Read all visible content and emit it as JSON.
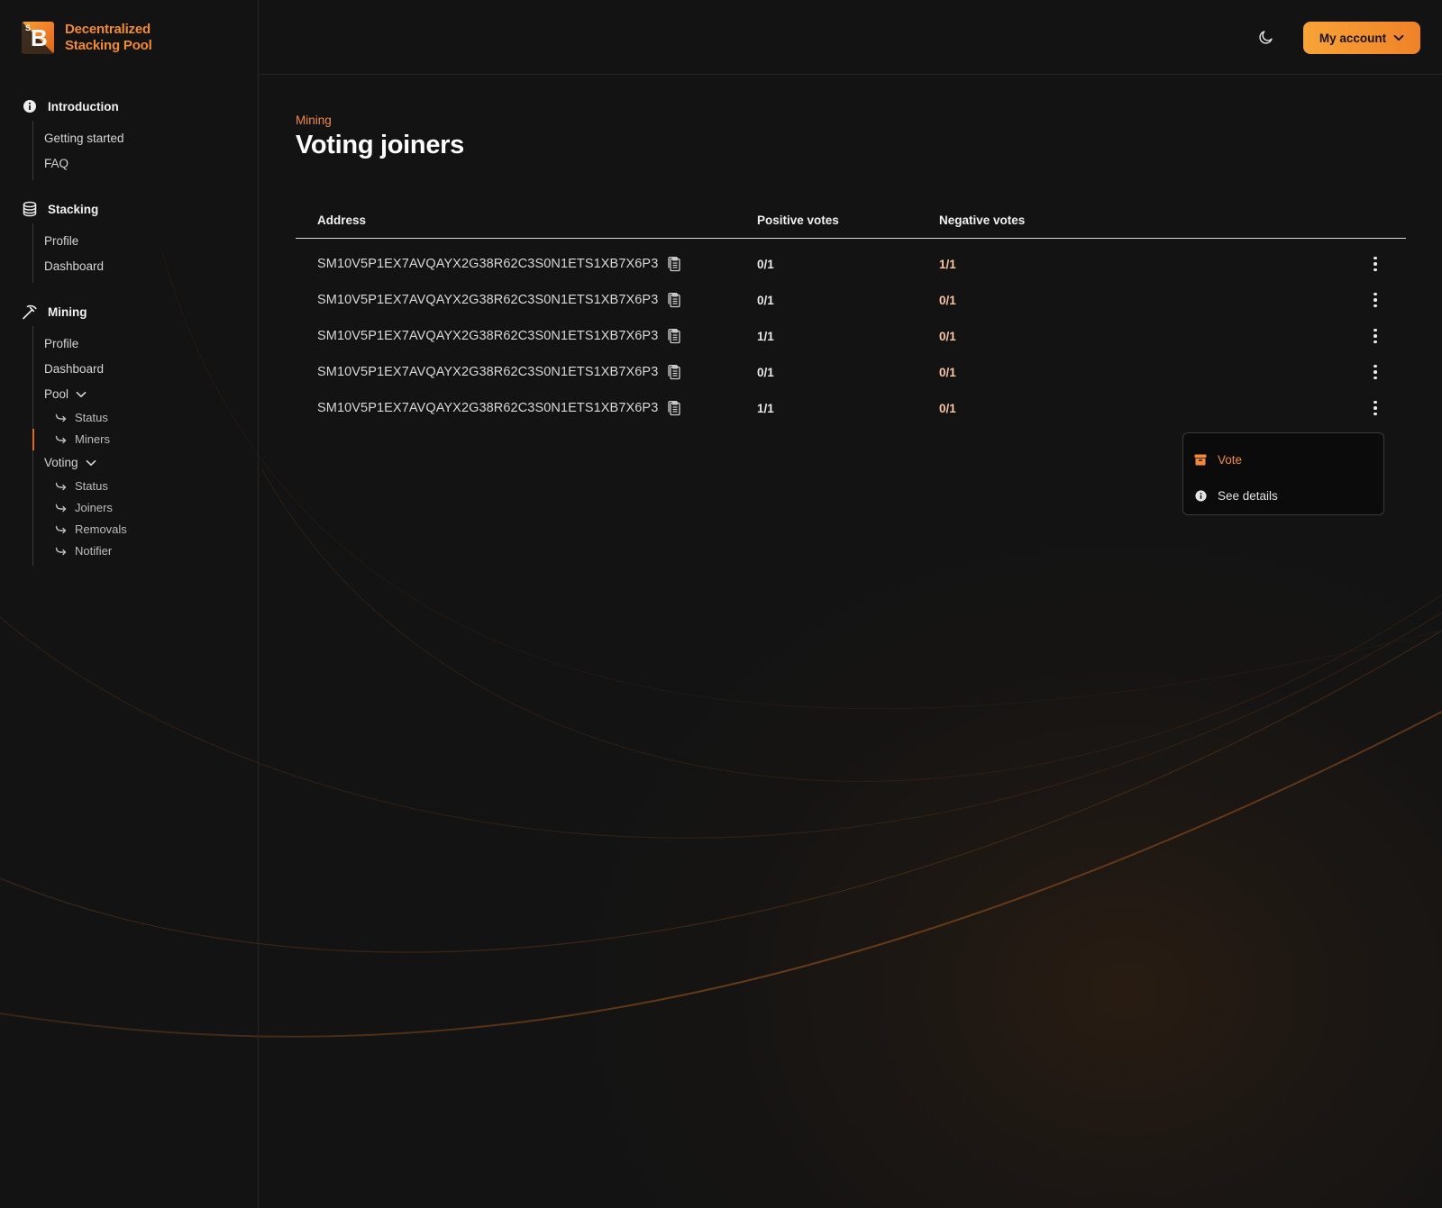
{
  "brand": {
    "logo_letter": "B",
    "logo_mark": "S",
    "name_line1": "Decentralized",
    "name_line2": "Stacking Pool"
  },
  "topbar": {
    "theme_icon": "moon-icon",
    "account_label": "My account"
  },
  "sidebar": {
    "sections": [
      {
        "label": "Introduction",
        "icon": "info-icon",
        "items": [
          "Getting started",
          "FAQ"
        ]
      },
      {
        "label": "Stacking",
        "icon": "database-icon",
        "items": [
          "Profile",
          "Dashboard"
        ]
      },
      {
        "label": "Mining",
        "icon": "pickaxe-icon",
        "items": [
          "Profile",
          "Dashboard"
        ],
        "groups": [
          {
            "label": "Pool",
            "children": [
              "Status",
              "Miners"
            ]
          },
          {
            "label": "Voting",
            "children": [
              "Status",
              "Joiners",
              "Removals",
              "Notifier"
            ]
          }
        ]
      }
    ]
  },
  "page": {
    "eyebrow": "Mining",
    "title": "Voting joiners"
  },
  "table": {
    "headers": {
      "address": "Address",
      "positive": "Positive votes",
      "negative": "Negative votes"
    },
    "rows": [
      {
        "address": "SM10V5P1EX7AVQAYX2G38R62C3S0N1ETS1XB7X6P3",
        "positive": "0/1",
        "negative": "1/1"
      },
      {
        "address": "SM10V5P1EX7AVQAYX2G38R62C3S0N1ETS1XB7X6P3",
        "positive": "0/1",
        "negative": "0/1"
      },
      {
        "address": "SM10V5P1EX7AVQAYX2G38R62C3S0N1ETS1XB7X6P3",
        "positive": "1/1",
        "negative": "0/1"
      },
      {
        "address": "SM10V5P1EX7AVQAYX2G38R62C3S0N1ETS1XB7X6P3",
        "positive": "0/1",
        "negative": "0/1"
      },
      {
        "address": "SM10V5P1EX7AVQAYX2G38R62C3S0N1ETS1XB7X6P3",
        "positive": "1/1",
        "negative": "0/1"
      }
    ]
  },
  "row_menu": {
    "vote_label": "Vote",
    "details_label": "See details"
  },
  "colors": {
    "background": "#131313",
    "accent": "#f08a3a",
    "button_gradient_start": "#f7a436",
    "button_gradient_end": "#ef8228",
    "negative_votes": "#f6c3a0"
  }
}
